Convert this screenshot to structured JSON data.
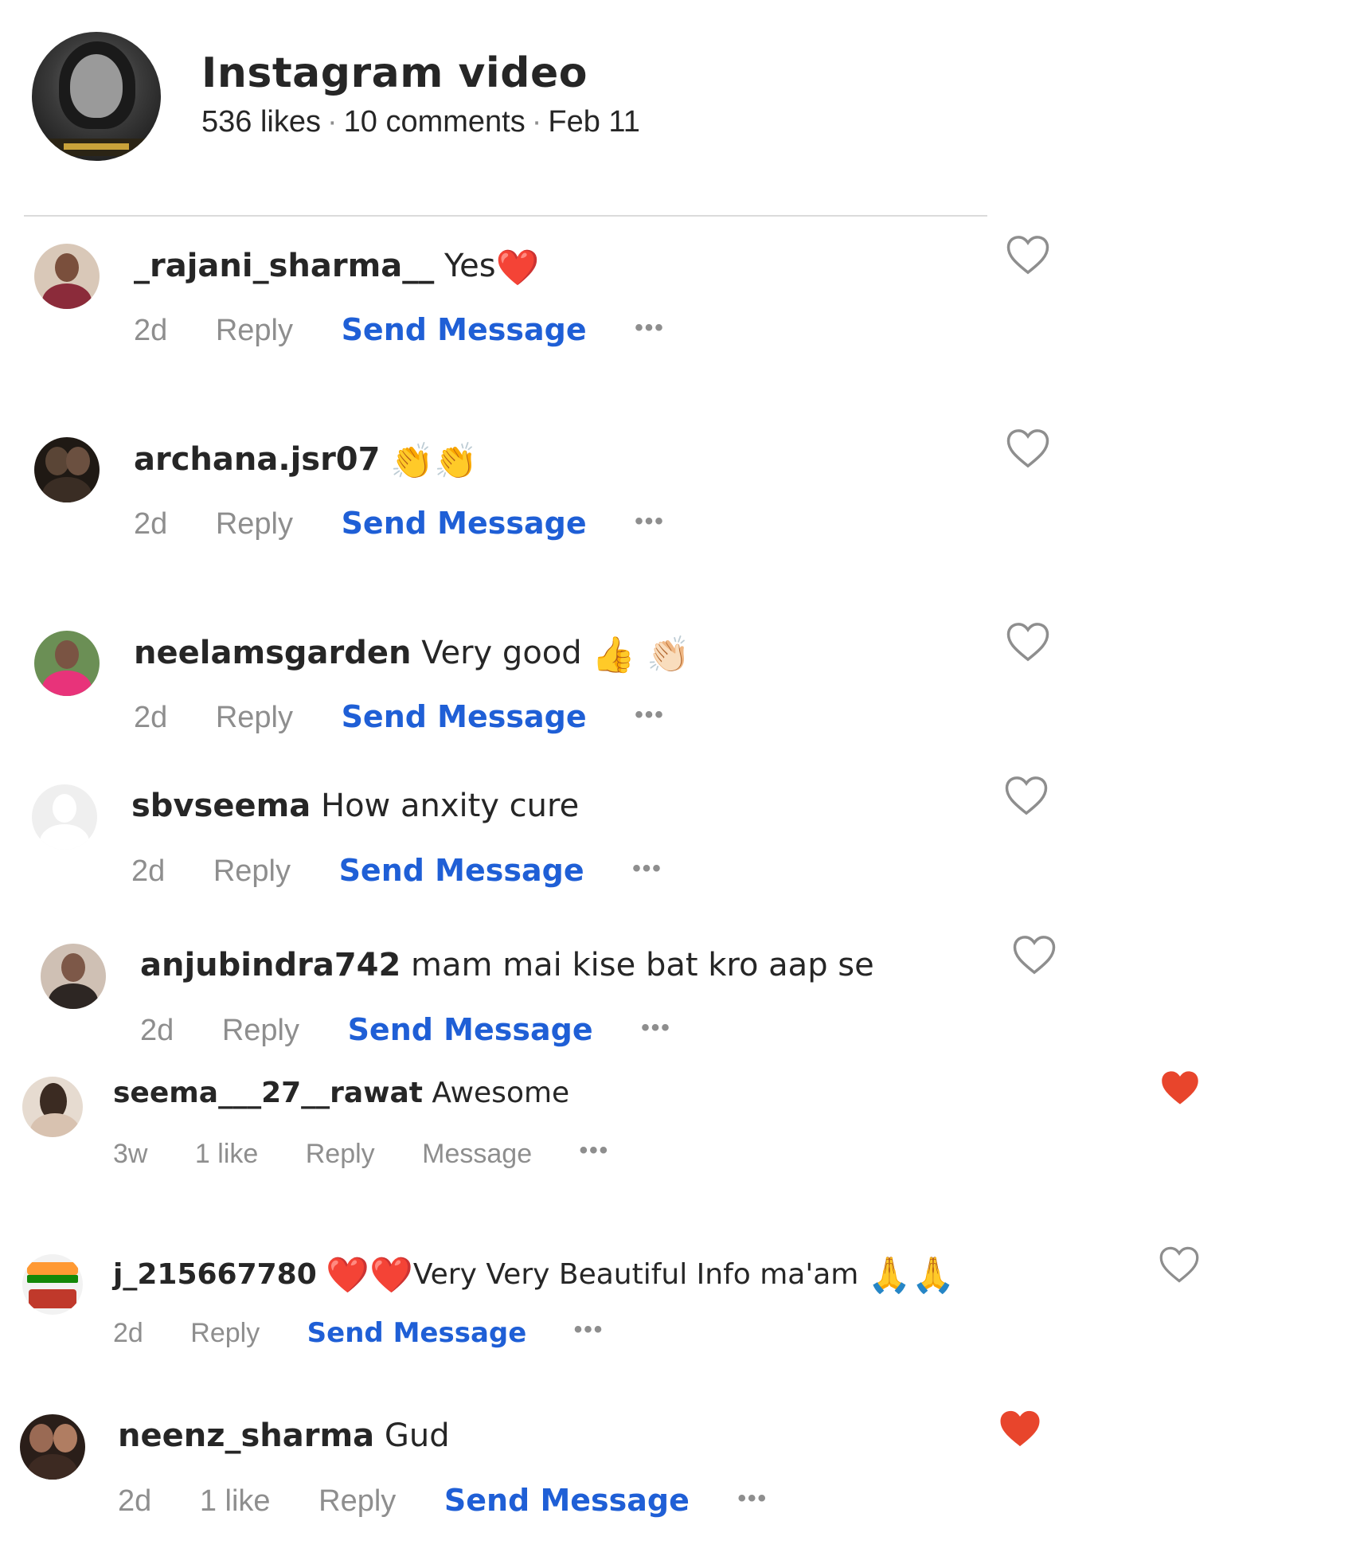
{
  "header": {
    "title": "Instagram video",
    "likes": "536 likes",
    "comments": "10 comments",
    "date": "Feb 11",
    "separator": "·"
  },
  "comments": [
    {
      "username": "_rajani_sharma__",
      "text": "Yes",
      "emoji": "❤️",
      "time": "2d",
      "likes": "",
      "reply": "Reply",
      "message": "Send Message",
      "more": "•••",
      "liked": false,
      "avatar_color": "#b07a6a"
    },
    {
      "username": "archana.jsr07",
      "text": "",
      "emoji": "👏👏",
      "time": "2d",
      "likes": "",
      "reply": "Reply",
      "message": "Send Message",
      "more": "•••",
      "liked": false,
      "avatar_color": "#2a231c"
    },
    {
      "username": "neelamsgarden",
      "text": "Very good",
      "emoji": "👍 👏🏻",
      "time": "2d",
      "likes": "",
      "reply": "Reply",
      "message": "Send Message",
      "more": "•••",
      "liked": false,
      "avatar_color": "#4d7a3a"
    },
    {
      "username": "sbvseema",
      "text": "How anxity cure",
      "emoji": "",
      "time": "2d",
      "likes": "",
      "reply": "Reply",
      "message": "Send Message",
      "more": "•••",
      "liked": false,
      "avatar_color": "#e6e6e6"
    },
    {
      "username": "anjubindra742",
      "text": "mam mai kise bat kro aap se",
      "emoji": "",
      "time": "2d",
      "likes": "",
      "reply": "Reply",
      "message": "Send Message",
      "more": "•••",
      "liked": false,
      "avatar_color": "#8a5f4a"
    },
    {
      "username": "seema___27__rawat",
      "text": "Awesome",
      "emoji": "",
      "time": "3w",
      "likes": "1 like",
      "reply": "Reply",
      "message": "Message",
      "more": "•••",
      "liked": true,
      "avatar_color": "#3b2b22"
    },
    {
      "username": "j_215667780",
      "text": "Very Very Beautiful Info ma'am",
      "emoji_before": "❤️❤️",
      "emoji": "🙏🙏",
      "time": "2d",
      "likes": "",
      "reply": "Reply",
      "message": "Send Message",
      "more": "•••",
      "liked": false,
      "avatar_color": "#c0392b"
    },
    {
      "username": "neenz_sharma",
      "text": "Gud",
      "emoji": "",
      "time": "2d",
      "likes": "1 like",
      "reply": "Reply",
      "message": "Send Message",
      "more": "•••",
      "liked": true,
      "avatar_color": "#3d2a22"
    }
  ],
  "colors": {
    "link_blue": "#1f5fd6",
    "muted_gray": "#8e8e8e",
    "heart_red": "#ed4956",
    "text": "#262626"
  }
}
